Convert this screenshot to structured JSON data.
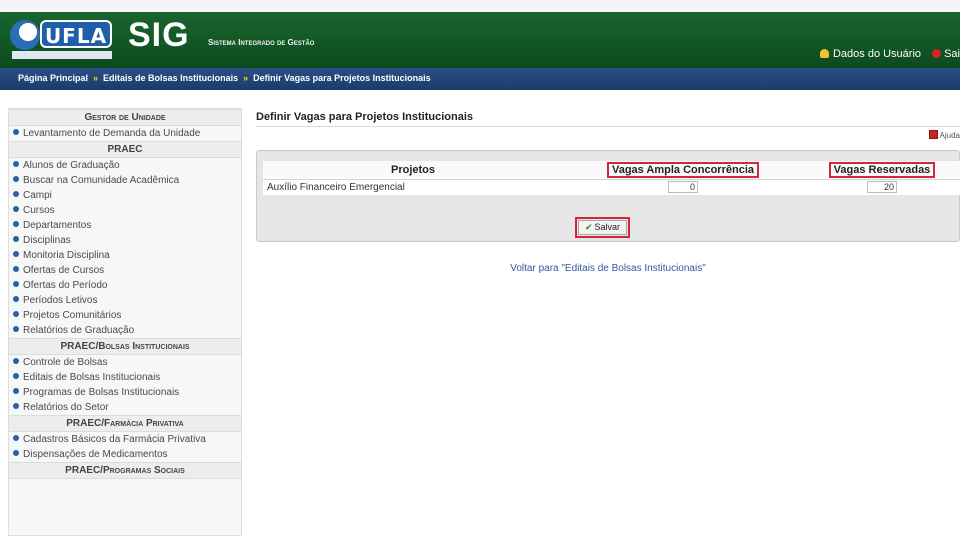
{
  "header": {
    "logo_text": "UFLA",
    "app_name": "SIG",
    "app_subtitle": "Sistema Integrado de Gestão",
    "user_data_link": "Dados do Usuário",
    "exit_link": "Sai"
  },
  "breadcrumb": {
    "items": [
      "Página Principal",
      "Editais de Bolsas Institucionais",
      "Definir Vagas para Projetos Institucionais"
    ],
    "separator": "»"
  },
  "sidebar": {
    "sections": [
      {
        "heading": "Gestor de Unidade",
        "items": [
          "Levantamento de Demanda da Unidade"
        ]
      },
      {
        "heading": "PRAEC",
        "items": [
          "Alunos de Graduação",
          "Buscar na Comunidade Acadêmica",
          "Campi",
          "Cursos",
          "Departamentos",
          "Disciplinas",
          "Monitoria Disciplina",
          "Ofertas de Cursos",
          "Ofertas do Período",
          "Períodos Letivos",
          "Projetos Comunitários",
          "Relatórios de Graduação"
        ]
      },
      {
        "heading": "PRAEC/Bolsas Institucionais",
        "items": [
          "Controle de Bolsas",
          "Editais de Bolsas Institucionais",
          "Programas de Bolsas Institucionais",
          "Relatórios do Setor"
        ]
      },
      {
        "heading": "PRAEC/Farmácia Privativa",
        "items": [
          "Cadastros Básicos da Farmácia Privativa",
          "Dispensações de Medicamentos"
        ]
      },
      {
        "heading": "PRAEC/Programas Sociais",
        "items": []
      }
    ]
  },
  "main": {
    "title": "Definir Vagas para Projetos Institucionais",
    "help_label": "Ajuda",
    "table": {
      "headers": [
        "Projetos",
        "Vagas Ampla Concorrência",
        "Vagas Reservadas"
      ],
      "rows": [
        {
          "project": "Auxílio Financeiro Emergencial",
          "vagas_ampla": "0",
          "vagas_reservadas": "20"
        }
      ]
    },
    "save_label": "Salvar",
    "back_link": "Voltar para \"Editais de Bolsas Institucionais\""
  },
  "colors": {
    "header_green": "#135a27",
    "breadcrumb_blue": "#1b3b6c",
    "highlight_red": "#d0273b",
    "link_blue": "#2f5a9e"
  }
}
